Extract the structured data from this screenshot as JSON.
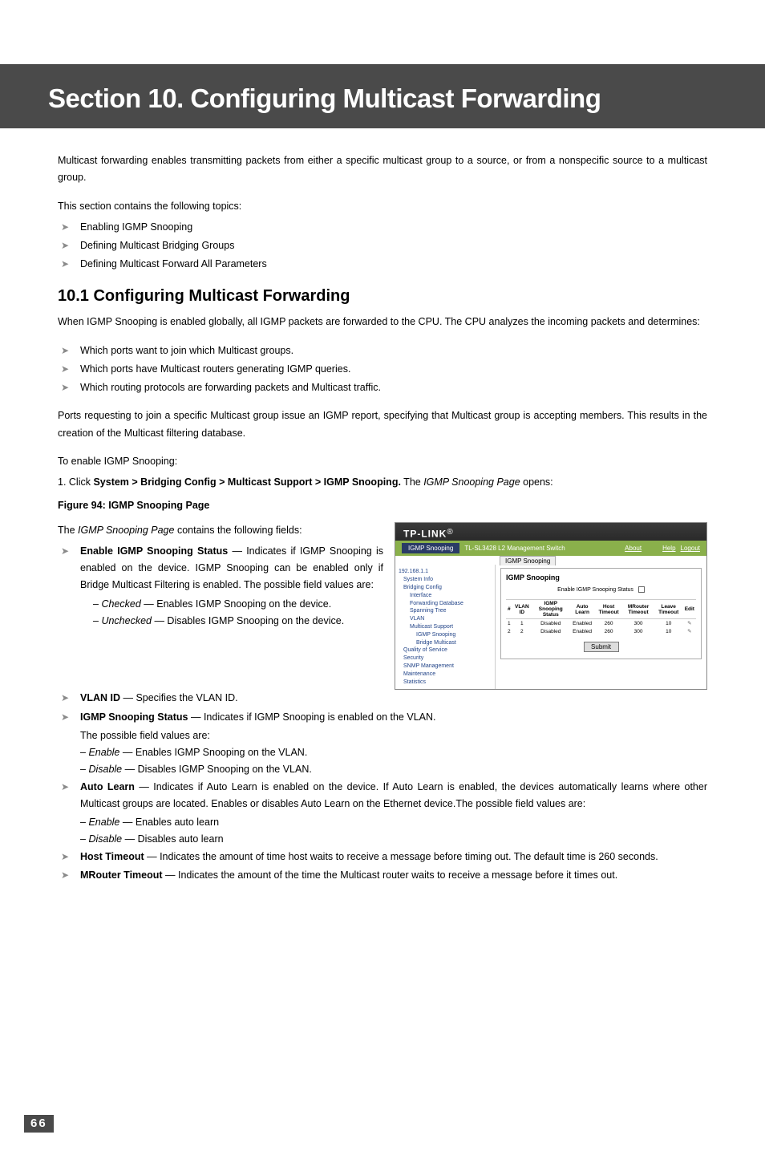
{
  "title": "Section 10.  Configuring Multicast Forwarding",
  "intro1": "Multicast forwarding enables transmitting packets from either a specific multicast group to a source, or from a nonspecific source to a multicast group.",
  "intro2": "This section contains the following topics:",
  "topics": [
    "Enabling IGMP Snooping",
    "Defining Multicast Bridging Groups",
    "Defining Multicast Forward All Parameters"
  ],
  "h2": "10.1   Configuring Multicast Forwarding",
  "h2_intro": "When IGMP Snooping is enabled globally, all IGMP packets are forwarded to the CPU. The CPU analyzes the incoming packets and determines:",
  "analyzes": [
    "Which ports want to join which Multicast groups.",
    "Which ports have Multicast routers generating IGMP queries.",
    "Which routing protocols are forwarding packets and Multicast traffic."
  ],
  "ports_para": "Ports requesting to join a specific Multicast group issue an IGMP report, specifying that Multicast group is accepting members. This results in the creation of the Multicast filtering database.",
  "enable_h": "To enable IGMP Snooping:",
  "enable_step_pre": "1.   Click ",
  "enable_step_bold": "System > Bridging Config > Multicast Support > IGMP Snooping.",
  "enable_step_mid": " The ",
  "enable_step_ital": "IGMP Snooping Page",
  "enable_step_post": " opens:",
  "figcap": "Figure 94: IGMP Snooping Page",
  "fields_intro_pre": "The ",
  "fields_intro_ital": "IGMP Snooping Page",
  "fields_intro_post": " contains the following fields:",
  "f1_b": "Enable IGMP Snooping Status",
  "f1_t": " — Indicates if IGMP Snooping is enabled on the device. IGMP Snooping can be enabled only if Bridge Multicast Filtering is enabled. The possible field values are:",
  "f1_c_i": "Checked",
  "f1_c_t": " — Enables IGMP Snooping on the device.",
  "f1_u_i": "Unchecked",
  "f1_u_t": " — Disables IGMP Snooping on the device.",
  "f2_b": "VLAN ID",
  "f2_t": " — Specifies the VLAN ID.",
  "f3_b": "IGMP Snooping Status",
  "f3_t": " — Indicates if IGMP Snooping is enabled on the VLAN.",
  "f3_sub": "The possible field values are:",
  "f3_e_i": "Enable",
  "f3_e_t": " — Enables IGMP Snooping on the VLAN.",
  "f3_d_i": "Disable",
  "f3_d_t": " — Disables IGMP Snooping on the VLAN.",
  "f4_b": "Auto Learn",
  "f4_t": " — Indicates if Auto Learn is enabled on the device. If Auto Learn is enabled, the devices automatically learns where other Multicast groups are located. Enables or disables Auto Learn on the Ethernet device.The possible field values are:",
  "f4_e_i": "Enable",
  "f4_e_t": " — Enables auto learn",
  "f4_d_i": "Disable",
  "f4_d_t": " — Disables auto learn",
  "f5_b": "Host Timeout",
  "f5_t": " — Indicates the amount of time host waits to receive a message before timing out. The default time is 260 seconds.",
  "f6_b": "MRouter Timeout",
  "f6_t": " — Indicates the amount of the time the Multicast router waits to receive a message before it times out.",
  "page_number": "66",
  "shot": {
    "logo": "TP-LINK",
    "crumb_box": "IGMP Snooping",
    "device": "TL-SL3428 L2 Management Switch",
    "about": "About",
    "help": "Help",
    "logout": "Logout",
    "tab": "IGMP Snooping",
    "heading": "IGMP Snooping",
    "cb_label": "Enable IGMP Snooping Status",
    "submit": "Submit",
    "tree": [
      {
        "t": "192.168.1.1",
        "cls": ""
      },
      {
        "t": "System Info",
        "cls": "tree-i1"
      },
      {
        "t": "Bridging Config",
        "cls": "tree-i1"
      },
      {
        "t": "Interface",
        "cls": "tree-i2"
      },
      {
        "t": "Forwarding Database",
        "cls": "tree-i2"
      },
      {
        "t": "Spanning Tree",
        "cls": "tree-i2"
      },
      {
        "t": "VLAN",
        "cls": "tree-i2"
      },
      {
        "t": "Multicast Support",
        "cls": "tree-i2"
      },
      {
        "t": "IGMP Snooping",
        "cls": "tree-i3"
      },
      {
        "t": "Bridge Multicast",
        "cls": "tree-i3"
      },
      {
        "t": "Quality of Service",
        "cls": "tree-i1"
      },
      {
        "t": "Security",
        "cls": "tree-i1"
      },
      {
        "t": "SNMP Management",
        "cls": "tree-i1"
      },
      {
        "t": "Maintenance",
        "cls": "tree-i1"
      },
      {
        "t": "Statistics",
        "cls": "tree-i1"
      }
    ],
    "th": [
      "#",
      "VLAN ID",
      "IGMP Snooping Status",
      "Auto Learn",
      "Host Timeout",
      "MRouter Timeout",
      "Leave Timeout",
      "Edit"
    ],
    "rows": [
      [
        "1",
        "1",
        "Disabled",
        "Enabled",
        "260",
        "300",
        "10",
        "✎"
      ],
      [
        "2",
        "2",
        "Disabled",
        "Enabled",
        "260",
        "300",
        "10",
        "✎"
      ]
    ]
  }
}
